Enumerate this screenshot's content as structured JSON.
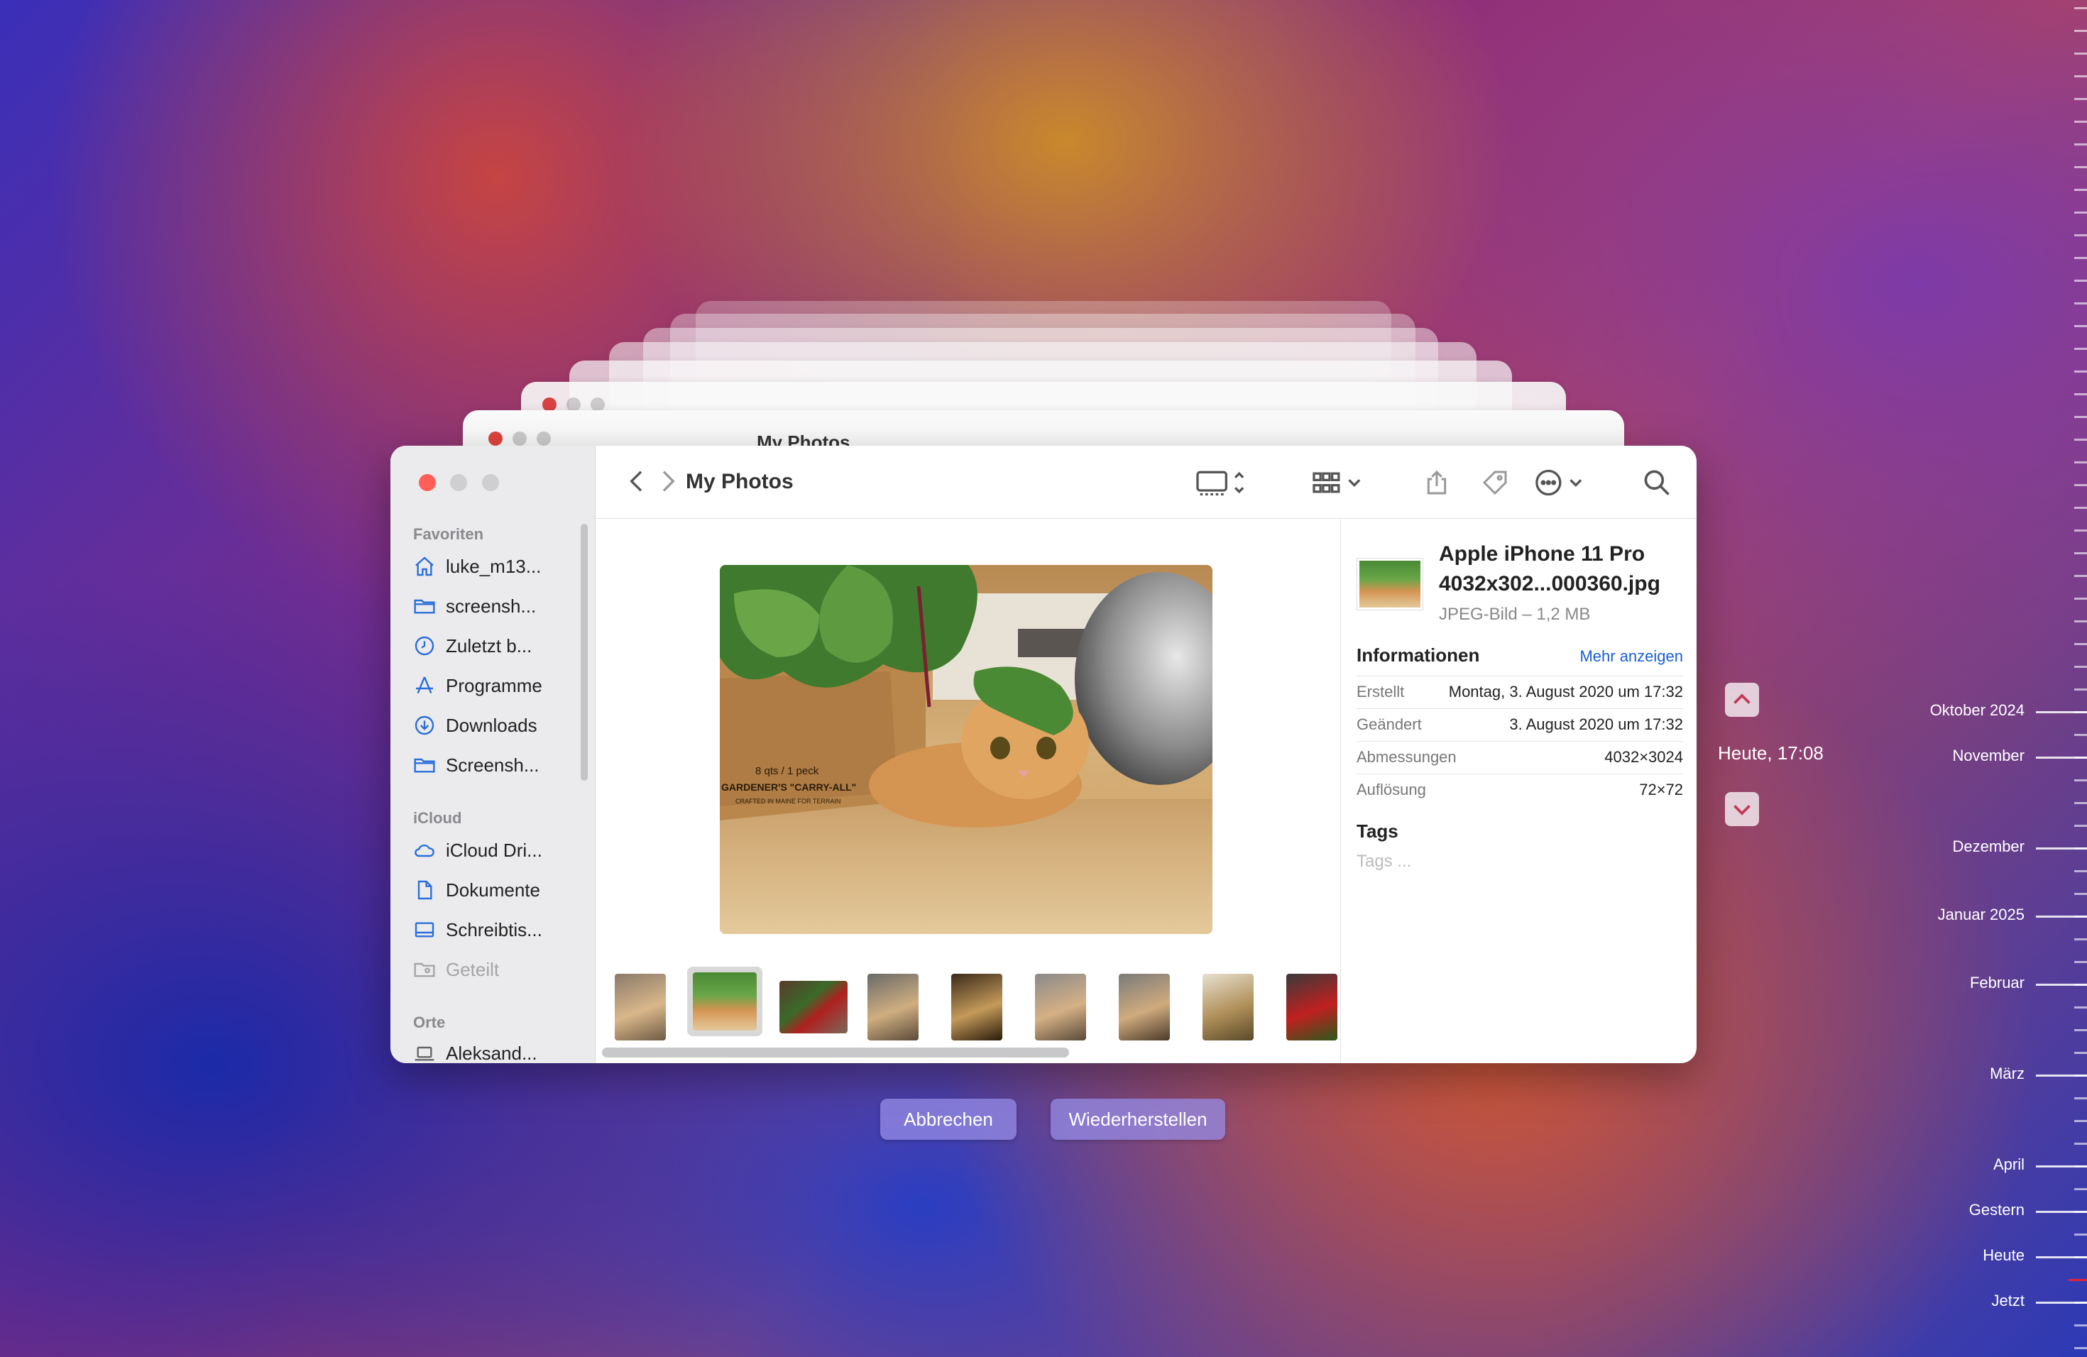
{
  "window": {
    "title": "My Photos"
  },
  "sidebar": {
    "sections": [
      {
        "header": "Favoriten",
        "items": [
          {
            "label": "luke_m13...",
            "icon": "home-icon"
          },
          {
            "label": "screensh...",
            "icon": "folder-icon"
          },
          {
            "label": "Zuletzt b...",
            "icon": "clock-icon"
          },
          {
            "label": "Programme",
            "icon": "apps-icon"
          },
          {
            "label": "Downloads",
            "icon": "download-icon"
          },
          {
            "label": "Screensh...",
            "icon": "folder-icon"
          }
        ]
      },
      {
        "header": "iCloud",
        "items": [
          {
            "label": "iCloud Dri...",
            "icon": "cloud-icon"
          },
          {
            "label": "Dokumente",
            "icon": "document-icon"
          },
          {
            "label": "Schreibtis...",
            "icon": "desktop-icon"
          },
          {
            "label": "Geteilt",
            "icon": "shared-folder-icon"
          }
        ]
      },
      {
        "header": "Orte",
        "items": [
          {
            "label": "Aleksand...",
            "icon": "laptop-icon"
          }
        ]
      }
    ]
  },
  "info": {
    "title_line1": "Apple iPhone 11 Pro",
    "title_line2": "4032x302...000360.jpg",
    "subtitle": "JPEG-Bild – 1,2 MB",
    "header": "Informationen",
    "more": "Mehr anzeigen",
    "rows": [
      {
        "key": "Erstellt",
        "value": "Montag, 3. August 2020 um 17:32"
      },
      {
        "key": "Geändert",
        "value": "3. August 2020 um 17:32"
      },
      {
        "key": "Abmessungen",
        "value": "4032×3024"
      },
      {
        "key": "Auflösung",
        "value": "72×72"
      }
    ],
    "tags_header": "Tags",
    "tags_placeholder": "Tags ..."
  },
  "photo_text": {
    "line1": "8 qts / 1 peck",
    "line2": "GARDENER'S \"CARRY-ALL\"",
    "line3": "CRAFTED IN MAINE FOR TERRAIN"
  },
  "buttons": {
    "cancel": "Abbrechen",
    "restore": "Wiederherstellen"
  },
  "time_machine": {
    "current": "Heute, 17:08",
    "labels": [
      "Oktober 2024",
      "November",
      "Dezember",
      "Januar 2025",
      "Februar",
      "März",
      "April",
      "Gestern",
      "Heute",
      "Jetzt"
    ]
  },
  "colors": {
    "close": "#ff5f57",
    "disabled_traffic": "#cfcfd1",
    "accent": "#1a5fd6",
    "sidebar_icon": "#2a6fdb"
  }
}
